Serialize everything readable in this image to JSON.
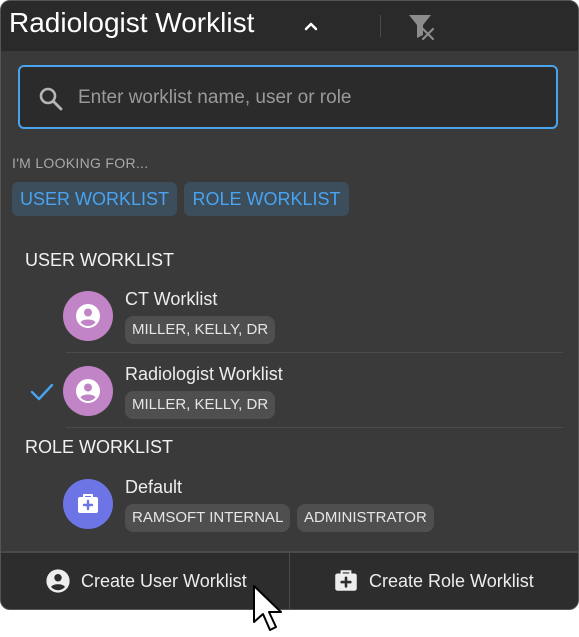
{
  "header": {
    "title": "Radiologist Worklist",
    "expand_icon": "chevron-up-icon",
    "clear_filter_icon": "filter-clear-icon"
  },
  "search": {
    "placeholder": "Enter worklist name, user or role",
    "value": "",
    "icon": "search-icon"
  },
  "filters": {
    "hint": "I'M LOOKING FOR...",
    "options": [
      "USER WORKLIST",
      "ROLE WORKLIST"
    ]
  },
  "sections": [
    {
      "label": "USER WORKLIST",
      "items": [
        {
          "name": "CT Worklist",
          "tags": [
            "MILLER, KELLY, DR"
          ],
          "selected": false,
          "icon": "user-avatar-icon"
        },
        {
          "name": "Radiologist Worklist",
          "tags": [
            "MILLER, KELLY, DR"
          ],
          "selected": true,
          "icon": "user-avatar-icon"
        }
      ]
    },
    {
      "label": "ROLE WORKLIST",
      "items": [
        {
          "name": "Default",
          "tags": [
            "RAMSOFT INTERNAL",
            "ADMINISTRATOR"
          ],
          "selected": false,
          "icon": "medical-kit-icon"
        }
      ]
    }
  ],
  "footer": {
    "create_user": "Create User Worklist",
    "create_role": "Create Role Worklist"
  },
  "colors": {
    "accent": "#4aa3ee",
    "panel_bg": "#3a3a3a",
    "user_avatar": "#c184c6",
    "role_avatar": "#6d74e5"
  }
}
